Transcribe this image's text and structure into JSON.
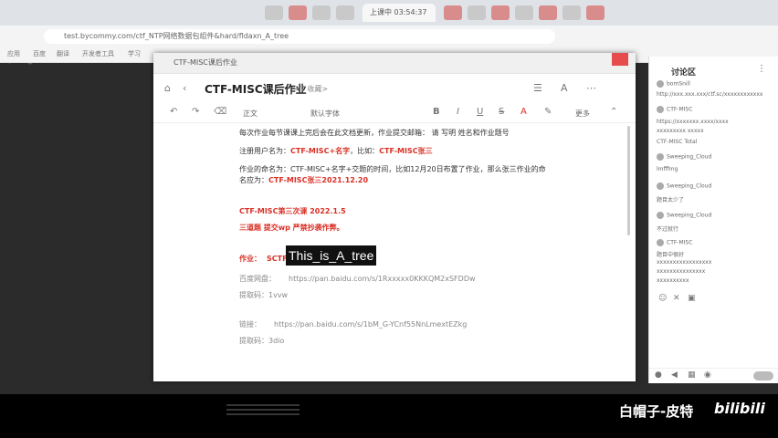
{
  "browser": {
    "active_tab_label": "上课中 03:54:37",
    "url": "test.bycommy.com/ctf_NTP网络数据包组件&hard/fldaxn_A_tree",
    "bookmarks": [
      "应用",
      "百度",
      "翻译",
      "开发者工具",
      "学习"
    ]
  },
  "doc": {
    "window_title": "CTF-MISC课后作业",
    "title": "CTF-MISC课后作业",
    "tag": "<7 收藏>",
    "toolbar_font_size": "正文",
    "toolbar_font_family": "默认字体",
    "toolbar_more": "更多",
    "lines": {
      "l1": "每次作业每节课课上完后会在此文档更新，作业提交邮箱：   请 写明 姓名和作业题号",
      "l2a": "注册用户名为：",
      "l2b": "CTF-MISC+名字",
      "l2c": "，比如：",
      "l2d": "CTF-MISC张三",
      "l3a": "作业的命名为：CTF-MISC+名字+交题的时间，比如12月20日布置了作业，那么张三作业的命",
      "l3b": "名应为：",
      "l3c": "CTF-MISC张三2021.12.20",
      "l4": "CTF-MISC第三次课 2022.1.5",
      "l5": "三道题 提交wp 严禁抄袭作弊。",
      "l6a": "作业：",
      "l6b": "SCTF",
      "l7a": "百度网盘：",
      "l7b": "https://pan.baidu.com/s/1Rxxxxx0KKKQM2xSFDDw",
      "l8": "提取码：1vvw",
      "l9a": "链接：",
      "l9b": "https://pan.baidu.com/s/1bM_G-YCnf55NnLmextEZkg",
      "l10": "提取码：3dio"
    }
  },
  "overlay_text": "This_is_A_tree",
  "discussion": {
    "title": "讨论区",
    "messages": [
      "bomSnill",
      "http://xxx.xxx.xxx/ctf.sc/xxxxxxxxxxxx",
      "CTF-MISC",
      "https://xxxxxxx.xxxx/xxxx",
      "xxxxxxxxx xxxxx",
      "CTF-MISC  Total",
      "Sweeping_Cloud",
      "lmfffmg",
      "Sweeping_Cloud",
      "题目太少了",
      "Sweeping_Cloud",
      "不过就行",
      "CTF-MISC",
      "题目中很好",
      "xxxxxxxxxxxxxxxxx",
      "xxxxxxxxxxxxxxx",
      "xxxxxxxxxx"
    ]
  },
  "watermark": {
    "text": "白帽子-皮特",
    "logo": "bilibili"
  },
  "colors": {
    "red": "#d93025",
    "accent_close": "#e74c4c"
  }
}
